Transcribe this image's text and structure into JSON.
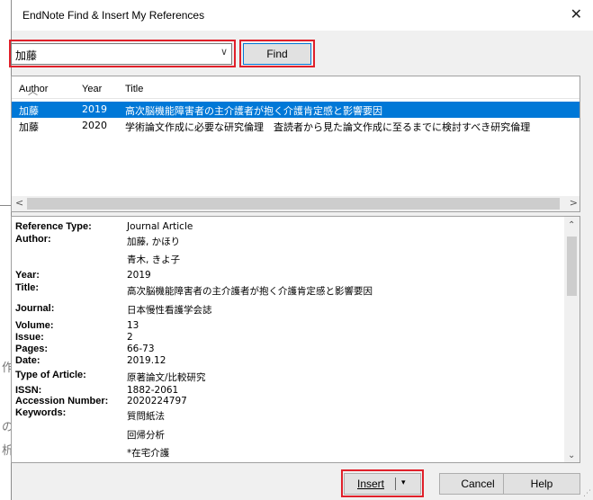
{
  "window": {
    "title": "EndNote Find & Insert My References",
    "close_glyph": "✕"
  },
  "search": {
    "value": "加藤",
    "dropdown_glyph": "∨",
    "find_label": "Find"
  },
  "list": {
    "columns": {
      "author": "Author",
      "year": "Year",
      "title": "Title"
    },
    "rows": [
      {
        "author": "加藤",
        "year": "2019",
        "title": "高次脳機能障害者の主介護者が抱く介護肯定感と影響要因",
        "selected": true
      },
      {
        "author": "加藤",
        "year": "2020",
        "title": "学術論文作成に必要な研究倫理　査読者から見た論文作成に至るまでに検討すべき研究倫理",
        "selected": false
      }
    ]
  },
  "details": {
    "reference_type_label": "Reference Type:",
    "reference_type": "Journal Article",
    "author_label": "Author:",
    "author_1": "加藤, かほり",
    "author_2": "青木, きよ子",
    "year_label": "Year:",
    "year": "2019",
    "title_label": "Title:",
    "title": "高次脳機能障害者の主介護者が抱く介護肯定感と影響要因",
    "journal_label": "Journal:",
    "journal": "日本慢性看護学会誌",
    "volume_label": "Volume:",
    "volume": "13",
    "issue_label": "Issue:",
    "issue": "2",
    "pages_label": "Pages:",
    "pages": "66-73",
    "date_label": "Date:",
    "date": "2019.12",
    "type_label": "Type of Article:",
    "type": "原著論文/比較研究",
    "issn_label": "ISSN:",
    "issn": "1882-2061",
    "accession_label": "Accession Number:",
    "accession": "2020224797",
    "keywords_label": "Keywords:",
    "keyword_1": "質問紙法",
    "keyword_2": "回帰分析",
    "keyword_3": "*在宅介護"
  },
  "buttons": {
    "insert": "Insert",
    "insert_caret": "▾",
    "cancel": "Cancel",
    "help": "Help"
  },
  "background_chars": [
    "作",
    "の",
    "析"
  ],
  "colors": {
    "selection": "#0078d7",
    "highlight_box": "#e0202a"
  }
}
